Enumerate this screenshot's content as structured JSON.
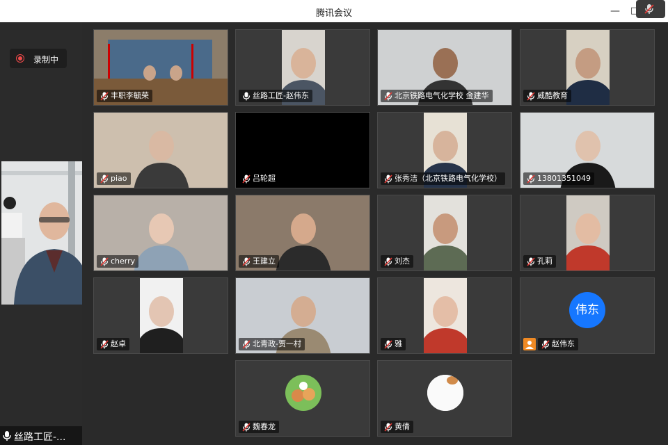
{
  "window": {
    "title": "腾讯会议",
    "minimize": "—",
    "maximize": "□"
  },
  "recording": {
    "label": "录制中"
  },
  "self_view": {
    "name": "丝路工匠-..."
  },
  "participants": [
    {
      "name": "丰职李毓荣",
      "muted": true
    },
    {
      "name": "丝路工匠-赵伟东",
      "muted": false
    },
    {
      "name": "北京铁路电气化学校  金建华",
      "muted": true
    },
    {
      "name": "威酷教育",
      "muted": true
    },
    {
      "name": "piao",
      "muted": true
    },
    {
      "name": "吕轮超",
      "muted": true
    },
    {
      "name": "张秀洁（北京铁路电气化学校）",
      "muted": true
    },
    {
      "name": "13801351049",
      "muted": true
    },
    {
      "name": "cherry",
      "muted": true
    },
    {
      "name": "王建立",
      "muted": true
    },
    {
      "name": "刘杰",
      "muted": true
    },
    {
      "name": "孔莉",
      "muted": true
    },
    {
      "name": "赵卓",
      "muted": true
    },
    {
      "name": "北青政-贾一村",
      "muted": true
    },
    {
      "name": "雅",
      "muted": true
    },
    {
      "name": "赵伟东",
      "muted": true,
      "avatar_text": "伟东",
      "avatar_color": "#1677ff"
    },
    {
      "name": "魏春龙",
      "muted": true
    },
    {
      "name": "黄倩",
      "muted": true
    }
  ],
  "colors": {
    "mute_red": "#e53935",
    "avatar_blue": "#1677ff",
    "host_orange": "#f08a24"
  }
}
